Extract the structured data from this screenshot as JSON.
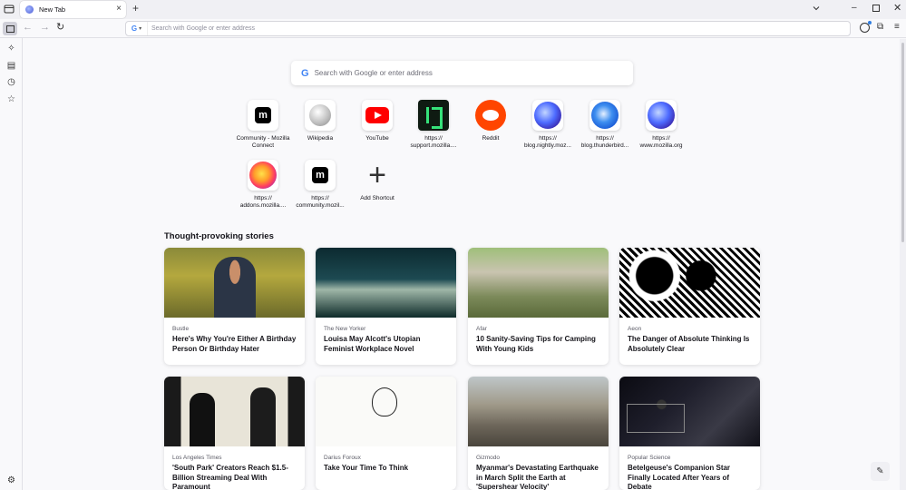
{
  "browser": {
    "tab": {
      "title": "New Tab"
    },
    "url_placeholder": "Search with Google or enter address",
    "search_engine_badge": "G"
  },
  "page": {
    "search_placeholder": "Search with Google or enter address",
    "search_engine_badge": "G",
    "shortcuts": [
      {
        "label": "Community - Mozilla Connect",
        "icon": "mozilla-m-icon"
      },
      {
        "label": "Wikipedia",
        "icon": "wikipedia-icon"
      },
      {
        "label": "YouTube",
        "icon": "youtube-icon"
      },
      {
        "label": "https:// support.mozilla....",
        "icon": "mozilla-support-icon"
      },
      {
        "label": "Reddit",
        "icon": "reddit-icon"
      },
      {
        "label": "https:// blog.nightly.moz...",
        "icon": "firefox-nightly-icon"
      },
      {
        "label": "https:// blog.thunderbird...",
        "icon": "thunderbird-icon"
      },
      {
        "label": "https:// www.mozilla.org",
        "icon": "firefox-nightly-icon"
      },
      {
        "label": "https:// addons.mozilla....",
        "icon": "firefox-icon"
      },
      {
        "label": "https:// community.mozil...",
        "icon": "mozilla-m-icon"
      },
      {
        "label": "Add Shortcut",
        "icon": "plus-icon"
      }
    ],
    "section_title": "Thought-provoking stories",
    "stories": [
      {
        "source": "Bustle",
        "headline": "Here's Why You're Either A Birthday Person Or Birthday Hater"
      },
      {
        "source": "The New Yorker",
        "headline": "Louisa May Alcott's Utopian Feminist Workplace Novel"
      },
      {
        "source": "Afar",
        "headline": "10 Sanity-Saving Tips for Camping With Young Kids"
      },
      {
        "source": "Aeon",
        "headline": "The Danger of Absolute Thinking Is Absolutely Clear"
      },
      {
        "source": "Los Angeles Times",
        "headline": "'South Park' Creators Reach $1.5-Billion Streaming Deal With Paramount"
      },
      {
        "source": "Darius Foroux",
        "headline": "Take Your Time To Think"
      },
      {
        "source": "Gizmodo",
        "headline": "Myanmar's Devastating Earthquake in March Split the Earth at 'Supershear Velocity'"
      },
      {
        "source": "Popular Science",
        "headline": "Betelgeuse's Companion Star Finally Located After Years of Debate"
      }
    ]
  }
}
